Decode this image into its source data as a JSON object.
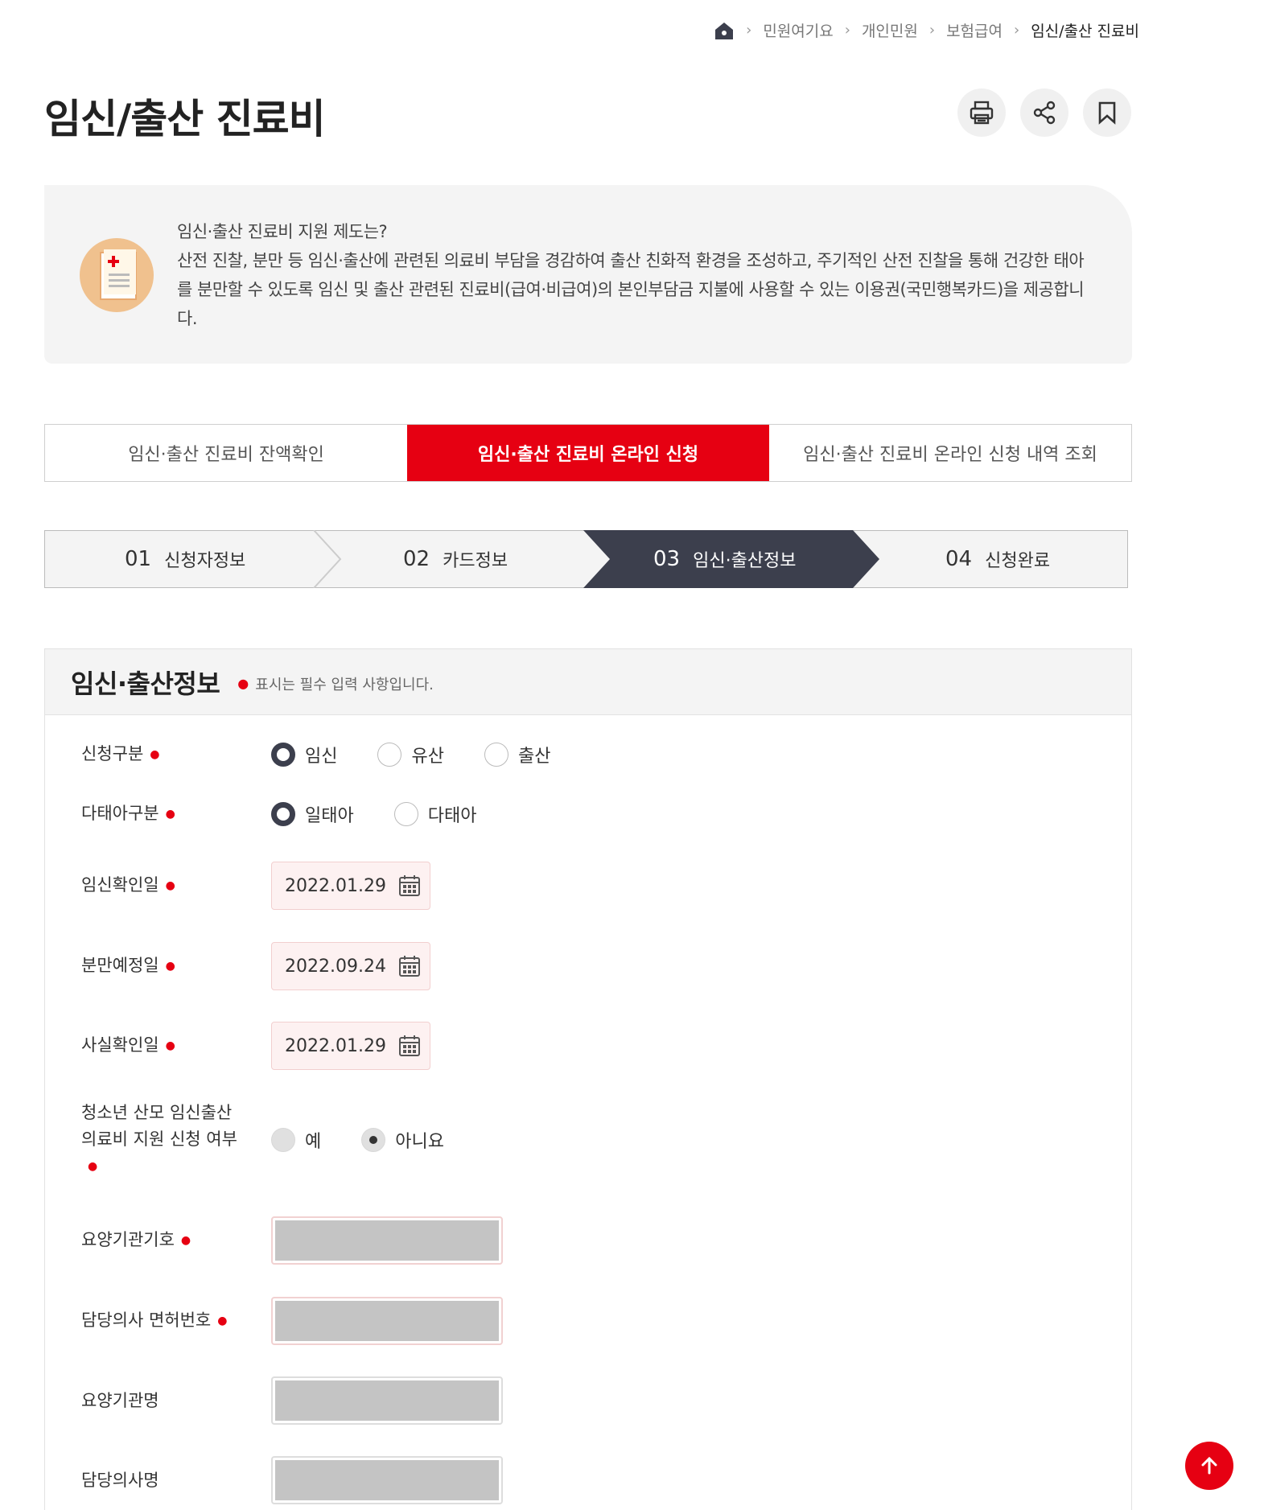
{
  "breadcrumb": {
    "items": [
      "민원여기요",
      "개인민원",
      "보험급여"
    ],
    "current": "임신/출산 진료비"
  },
  "page": {
    "title": "임신/출산 진료비"
  },
  "info": {
    "heading": "임신·출산 진료비 지원 제도는?",
    "body": "산전 진찰, 분만 등 임신·출산에 관련된 의료비 부담을 경감하여 출산 친화적 환경을 조성하고, 주기적인 산전 진찰을 통해 건강한 태아를 분만할 수 있도록 임신 및 출산 관련된 진료비(급여·비급여)의 본인부담금 지불에 사용할 수 있는 이용권(국민행복카드)을 제공합니다."
  },
  "tabs": [
    {
      "label": "임신·출산 진료비 잔액확인",
      "active": false
    },
    {
      "label": "임신·출산 진료비 온라인 신청",
      "active": true
    },
    {
      "label": "임신·출산 진료비 온라인 신청 내역 조회",
      "active": false
    }
  ],
  "steps": [
    {
      "num": "01",
      "label": "신청자정보"
    },
    {
      "num": "02",
      "label": "카드정보"
    },
    {
      "num": "03",
      "label": "임신·출산정보"
    },
    {
      "num": "04",
      "label": "신청완료"
    }
  ],
  "section": {
    "title": "임신·출산정보",
    "req_mark": "●",
    "note": "표시는 필수 입력 사항입니다."
  },
  "form": {
    "apply_type": {
      "label": "신청구분",
      "options": [
        "임신",
        "유산",
        "출산"
      ],
      "selected": "임신"
    },
    "fetus_type": {
      "label": "다태아구분",
      "options": [
        "일태아",
        "다태아"
      ],
      "selected": "일태아"
    },
    "pregnancy_confirm_date": {
      "label": "임신확인일",
      "value": "2022.01.29"
    },
    "due_date": {
      "label": "분만예정일",
      "value": "2022.09.24"
    },
    "fact_confirm_date": {
      "label": "사실확인일",
      "value": "2022.01.29"
    },
    "teen_support": {
      "label": "청소년 산모 임신출산 의료비 지원 신청 여부",
      "options": [
        "예",
        "아니요"
      ],
      "selected": "아니요"
    },
    "institution_code": {
      "label": "요양기관기호"
    },
    "doctor_license": {
      "label": "담당의사 면허번호"
    },
    "institution_name": {
      "label": "요양기관명"
    },
    "doctor_name": {
      "label": "담당의사명"
    }
  },
  "colors": {
    "accent": "#e60012",
    "step_active": "#3c3f4d",
    "panel_bg": "#f4f4f4"
  },
  "icons": [
    "home-icon",
    "print-icon",
    "share-icon",
    "bookmark-icon",
    "calendar-icon",
    "arrow-up-icon"
  ]
}
